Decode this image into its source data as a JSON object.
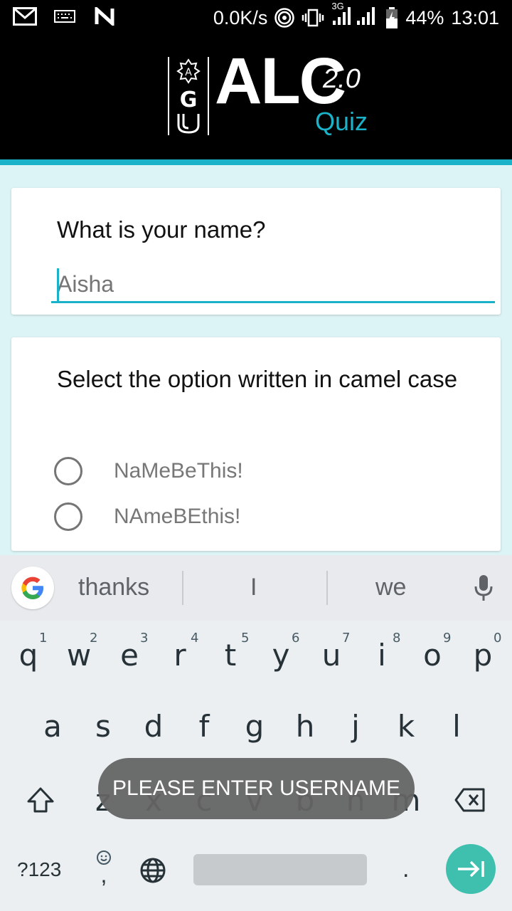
{
  "status_bar": {
    "net_speed": "0.0K/s",
    "network_type": "3G",
    "battery": "44%",
    "time": "13:01",
    "icons": [
      "gmail-icon",
      "keyboard-icon",
      "n-icon",
      "hotspot-icon",
      "vibrate-icon",
      "signal-icon",
      "battery-icon"
    ]
  },
  "header": {
    "logo_title": "ALC",
    "logo_version": "2.0",
    "logo_subtitle": "Quiz",
    "accent_color": "#1ab2c9"
  },
  "questions": [
    {
      "title": "What is your name?",
      "input_placeholder": "Aisha"
    },
    {
      "title": "Select the option written in camel case",
      "options": [
        "NaMeBeThis!",
        "NAmeBEthis!"
      ]
    }
  ],
  "keyboard": {
    "suggestions": [
      "thanks",
      "I",
      "we"
    ],
    "row1": [
      "q",
      "w",
      "e",
      "r",
      "t",
      "y",
      "u",
      "i",
      "o",
      "p"
    ],
    "row1_hints": [
      "1",
      "2",
      "3",
      "4",
      "5",
      "6",
      "7",
      "8",
      "9",
      "0"
    ],
    "row2": [
      "a",
      "s",
      "d",
      "f",
      "g",
      "h",
      "j",
      "k",
      "l"
    ],
    "row3": [
      "z",
      "x",
      "c",
      "v",
      "b",
      "n",
      "m"
    ],
    "symbols_label": "?123",
    "comma": ",",
    "period": ".",
    "enter_color": "#3fbfae"
  },
  "toast": {
    "message": "PLEASE ENTER USERNAME"
  }
}
